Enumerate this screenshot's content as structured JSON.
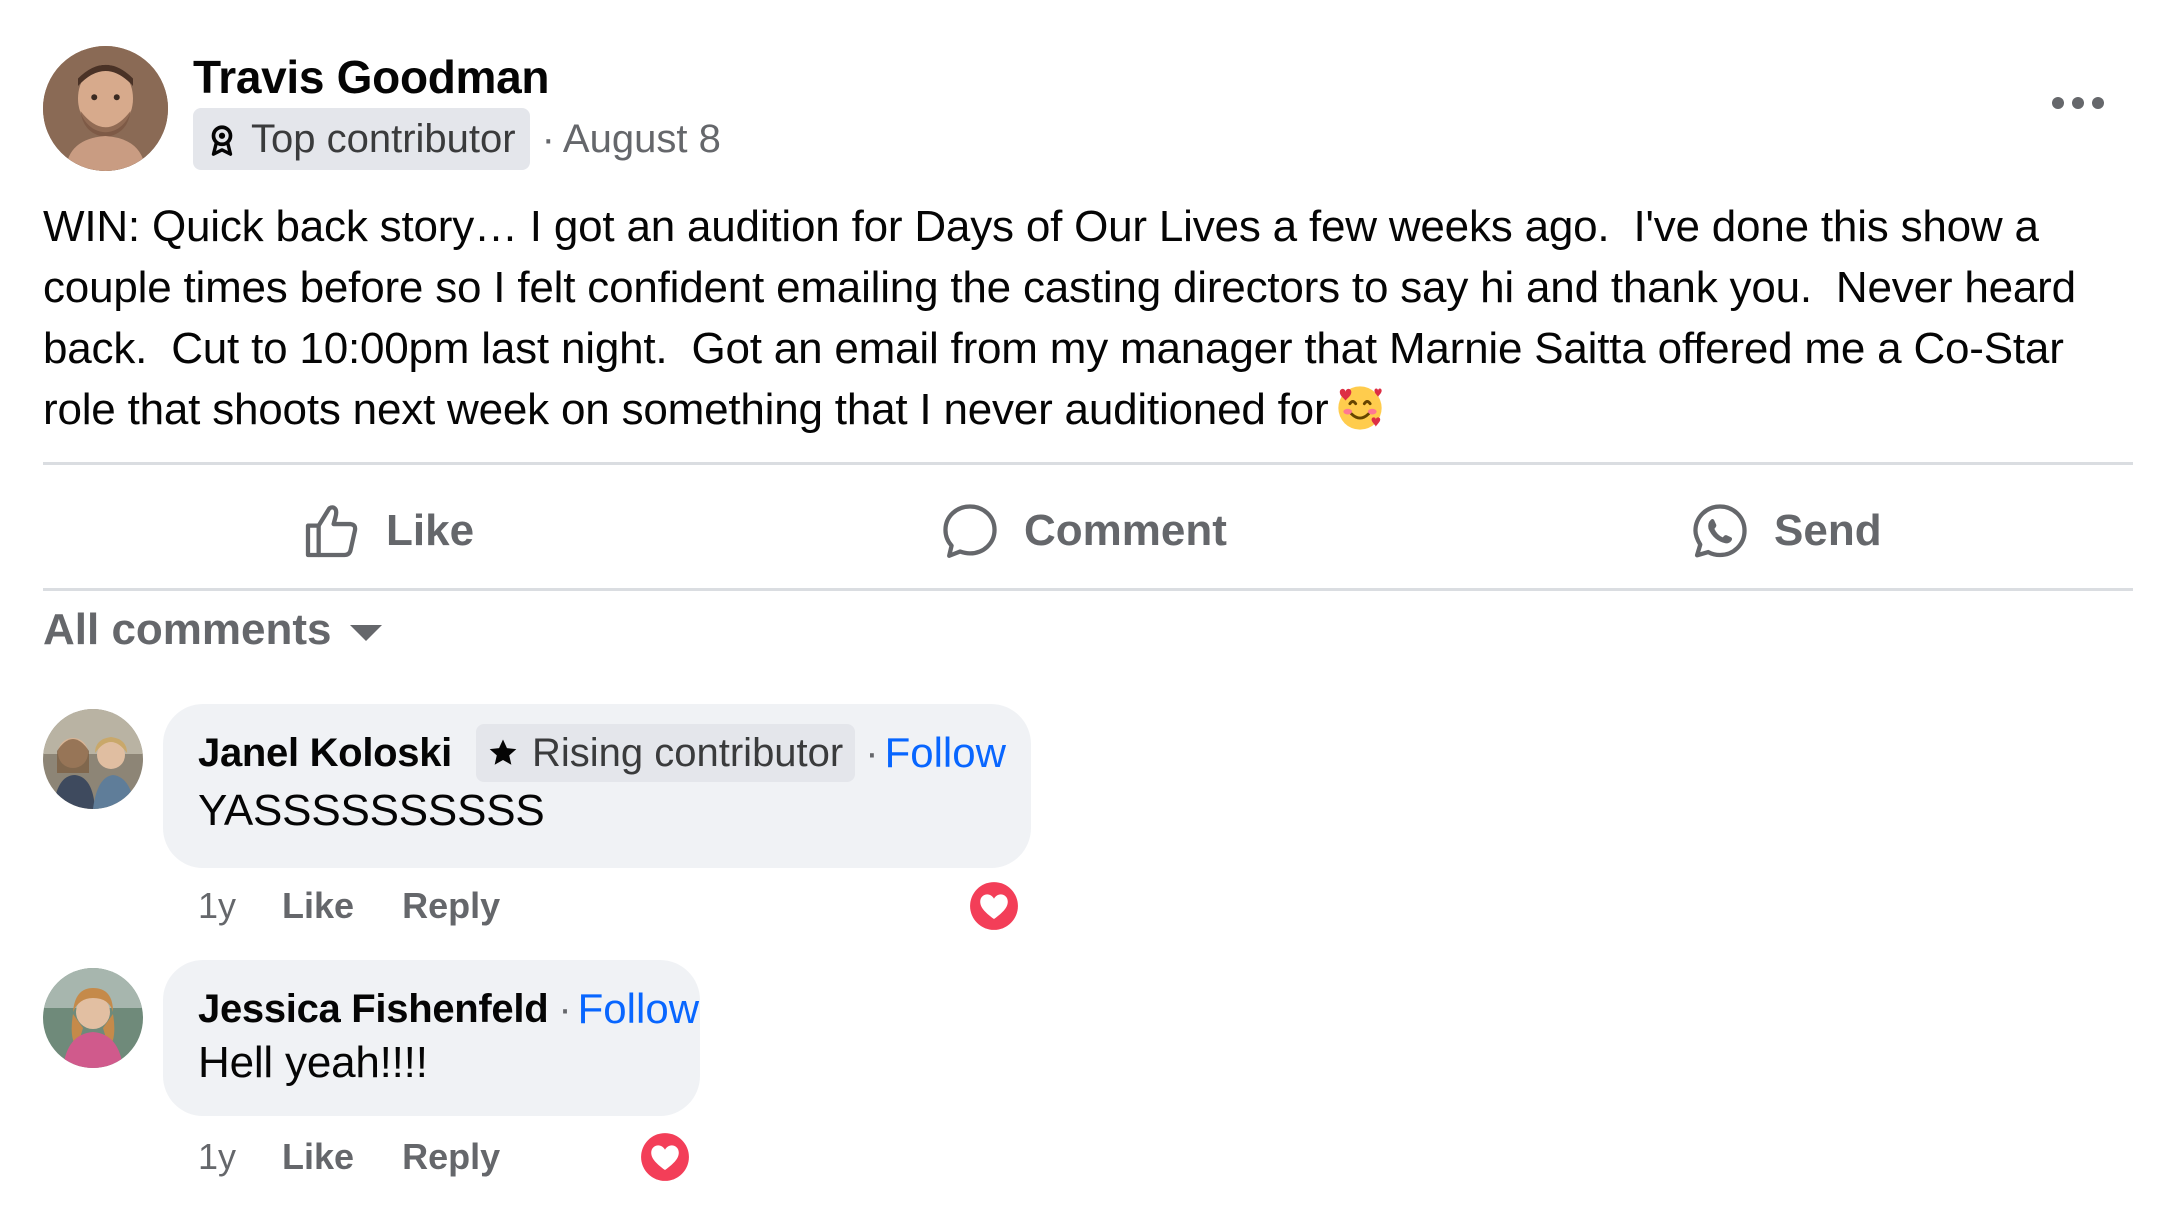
{
  "post": {
    "author": "Travis Goodman",
    "badge_label": "Top contributor",
    "badge_icon": "award-icon",
    "meta_separator": "·",
    "date": "August 8",
    "body": "WIN: Quick back story… I got an audition for Days of Our Lives a few weeks ago.  I've done this show a couple times before so I felt confident emailing the casting directors to say hi and thank you.  Never heard back.  Cut to 10:00pm last night.  Got an email from my manager that Marnie Saitta offered me a Co-Star role that shoots next week on something that I never auditioned for",
    "body_emoji": "smiling-face-with-hearts-emoji"
  },
  "actions": {
    "like": "Like",
    "comment": "Comment",
    "send": "Send"
  },
  "comments_filter": "All comments",
  "comments": [
    {
      "name": "Janel Koloski",
      "badge_label": "Rising contributor",
      "badge_icon": "star-icon",
      "separator": "·",
      "follow": "Follow",
      "text": "YASSSSSSSSSS",
      "time": "1y",
      "like": "Like",
      "reply": "Reply",
      "reaction": "heart-reaction-icon"
    },
    {
      "name": "Jessica Fishenfeld",
      "separator": "·",
      "follow": "Follow",
      "text": "Hell yeah!!!!",
      "time": "1y",
      "like": "Like",
      "reply": "Reply",
      "reaction": "heart-reaction-icon"
    }
  ],
  "colors": {
    "link_blue": "#0866ff",
    "secondary_text": "#65676b",
    "bubble_bg": "#f0f2f5",
    "badge_bg": "#e4e6eb",
    "heart_red": "#f33e58"
  }
}
